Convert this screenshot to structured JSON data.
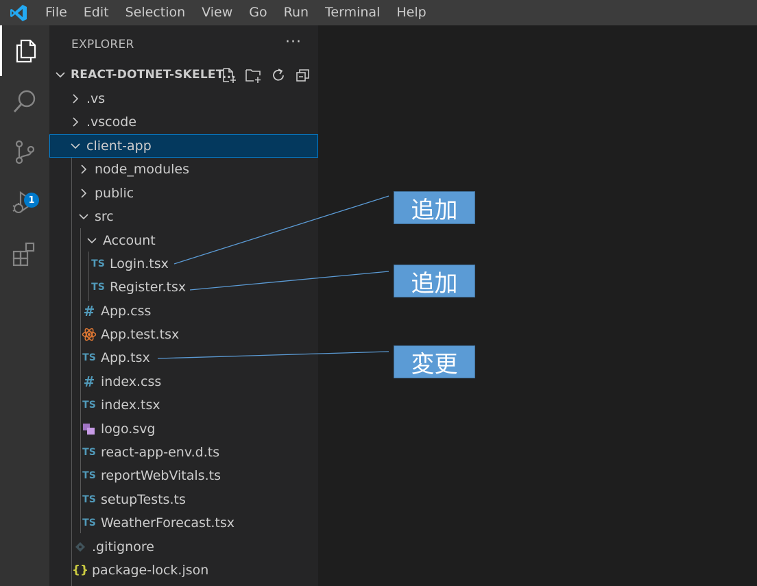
{
  "menu": [
    "File",
    "Edit",
    "Selection",
    "View",
    "Go",
    "Run",
    "Terminal",
    "Help"
  ],
  "activity": {
    "items": [
      "explorer",
      "search",
      "source-control",
      "run-debug",
      "extensions"
    ],
    "debug_badge": "1"
  },
  "explorer": {
    "title": "EXPLORER",
    "more": "···",
    "workspace": "REACT-DOTNET-SKELET...",
    "workspace_actions": [
      "new-file",
      "new-folder",
      "refresh",
      "collapse-all"
    ],
    "tree": [
      {
        "label": ".vs",
        "type": "folder",
        "expanded": false
      },
      {
        "label": ".vscode",
        "type": "folder",
        "expanded": false
      },
      {
        "label": "client-app",
        "type": "folder",
        "expanded": true,
        "selected": true
      },
      {
        "label": "node_modules",
        "type": "folder",
        "expanded": false
      },
      {
        "label": "public",
        "type": "folder",
        "expanded": false
      },
      {
        "label": "src",
        "type": "folder",
        "expanded": true
      },
      {
        "label": "Account",
        "type": "folder",
        "expanded": true
      },
      {
        "label": "Login.tsx",
        "type": "ts"
      },
      {
        "label": "Register.tsx",
        "type": "ts"
      },
      {
        "label": "App.css",
        "type": "css"
      },
      {
        "label": "App.test.tsx",
        "type": "react"
      },
      {
        "label": "App.tsx",
        "type": "ts"
      },
      {
        "label": "index.css",
        "type": "css"
      },
      {
        "label": "index.tsx",
        "type": "ts"
      },
      {
        "label": "logo.svg",
        "type": "svg"
      },
      {
        "label": "react-app-env.d.ts",
        "type": "ts"
      },
      {
        "label": "reportWebVitals.ts",
        "type": "ts"
      },
      {
        "label": "setupTests.ts",
        "type": "ts"
      },
      {
        "label": "WeatherForecast.tsx",
        "type": "ts"
      },
      {
        "label": ".gitignore",
        "type": "git"
      },
      {
        "label": "package-lock.json",
        "type": "json"
      }
    ],
    "ts_badge": "TS",
    "css_badge": "#",
    "json_badge": "{}"
  },
  "annotations": [
    {
      "label": "追加",
      "target": "Login.tsx"
    },
    {
      "label": "追加",
      "target": "Register.tsx"
    },
    {
      "label": "変更",
      "target": "App.tsx"
    }
  ],
  "colors": {
    "titlebar": "#3c3c3c",
    "activitybar": "#333333",
    "sidebar": "#252526",
    "editor": "#1e1e1e",
    "accent": "#007acc",
    "ts_icon": "#519aba",
    "callout": "#5b9bd5"
  }
}
